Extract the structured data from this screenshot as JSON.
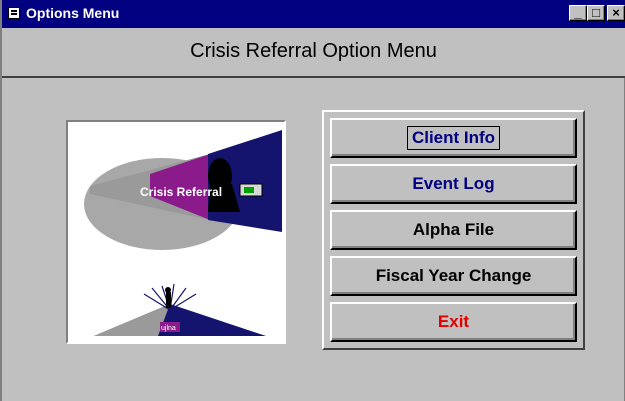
{
  "window": {
    "title": "Options Menu",
    "controls": {
      "minimize": "_",
      "maximize": "□",
      "close": "×"
    }
  },
  "header": {
    "title": "Crisis Referral Option Menu"
  },
  "image": {
    "label": "Crisis Referral",
    "small_label": "ujlna"
  },
  "buttons": {
    "client_info": "Client Info",
    "event_log": "Event Log",
    "alpha_file": "Alpha File",
    "fiscal_year_change": "Fiscal Year Change",
    "exit": "Exit"
  },
  "colors": {
    "titlebar": "#000080",
    "face": "#c0c0c0",
    "nav_label": "#000080",
    "exit_label": "#e00000",
    "logo_purple": "#8b1a8b",
    "logo_navy": "#14146e",
    "logo_gray": "#9a9a9a"
  }
}
